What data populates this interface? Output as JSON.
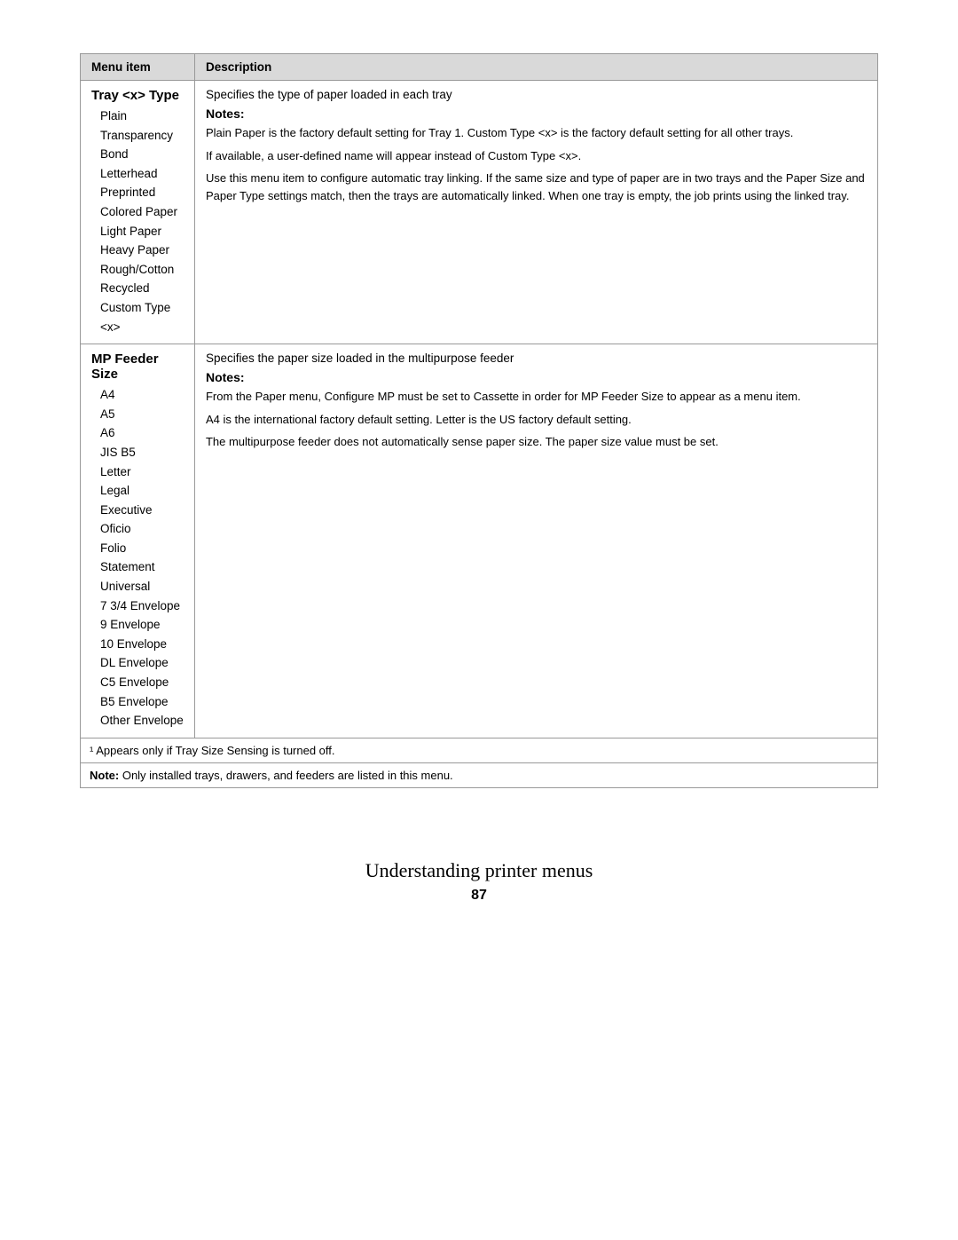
{
  "header": {
    "col1": "Menu item",
    "col2": "Description"
  },
  "rows": [
    {
      "section": "Tray <x> Type",
      "menuItems": [
        "Plain",
        "Transparency",
        "Bond",
        "Letterhead",
        "Preprinted",
        "Colored Paper",
        "Light Paper",
        "Heavy Paper",
        "Rough/Cotton",
        "Recycled",
        "Custom Type <x>"
      ],
      "descIntro": "Specifies the type of paper loaded in each tray",
      "notesLabel": "Notes:",
      "noteItems": [
        "Plain Paper is the factory default setting for Tray 1. Custom Type <x> is the factory default setting for all other trays.",
        "If available, a user-defined name will appear instead of Custom Type <x>.",
        "Use this menu item to configure automatic tray linking. If the same size and type of paper are in two trays and the Paper Size and Paper Type settings match, then the trays are automatically linked. When one tray is empty, the job prints using the linked tray."
      ]
    },
    {
      "section": "MP Feeder Size",
      "menuItems": [
        "A4",
        "A5",
        "A6",
        "JIS B5",
        "Letter",
        "Legal",
        "Executive",
        "Oficio",
        "Folio",
        "Statement",
        "Universal",
        "7 3/4 Envelope",
        "9 Envelope",
        "10 Envelope",
        "DL Envelope",
        "C5 Envelope",
        "B5 Envelope",
        "Other Envelope"
      ],
      "descIntro": "Specifies the paper size loaded in the multipurpose feeder",
      "notesLabel": "Notes:",
      "noteItems": [
        "From the Paper menu, Configure MP must be set to Cassette in order for MP Feeder Size to appear as a menu item.",
        "A4 is the international factory default setting. Letter is the US factory default setting.",
        "The multipurpose feeder does not automatically sense paper size. The paper size value must be set."
      ]
    }
  ],
  "footerNotes": [
    "¹ Appears only if Tray Size Sensing is turned off.",
    "Note: Only installed trays, drawers, and feeders are listed in this menu."
  ],
  "pageBottom": {
    "title": "Understanding printer menus",
    "pageNumber": "87"
  }
}
